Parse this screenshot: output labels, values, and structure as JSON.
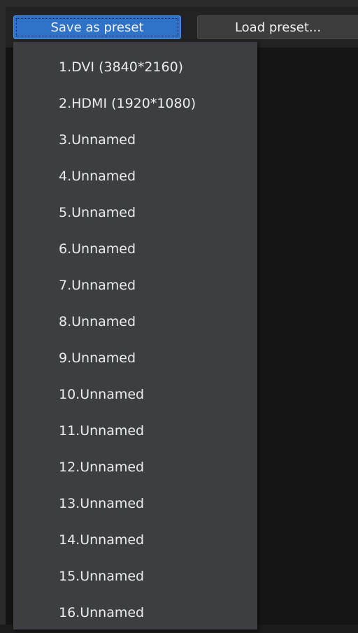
{
  "toolbar": {
    "save_preset_label": "Save as preset",
    "load_preset_label": "Load preset..."
  },
  "preset_menu": {
    "items": [
      {
        "label": "1.DVI (3840*2160)"
      },
      {
        "label": "2.HDMI (1920*1080)"
      },
      {
        "label": "3.Unnamed"
      },
      {
        "label": "4.Unnamed"
      },
      {
        "label": "5.Unnamed"
      },
      {
        "label": "6.Unnamed"
      },
      {
        "label": "7.Unnamed"
      },
      {
        "label": "8.Unnamed"
      },
      {
        "label": "9.Unnamed"
      },
      {
        "label": "10.Unnamed"
      },
      {
        "label": "11.Unnamed"
      },
      {
        "label": "12.Unnamed"
      },
      {
        "label": "13.Unnamed"
      },
      {
        "label": "14.Unnamed"
      },
      {
        "label": "15.Unnamed"
      },
      {
        "label": "16.Unnamed"
      }
    ]
  },
  "colors": {
    "accent_button": "#2f73c9",
    "menu_background": "#3d3e42",
    "app_background": "#131313"
  }
}
